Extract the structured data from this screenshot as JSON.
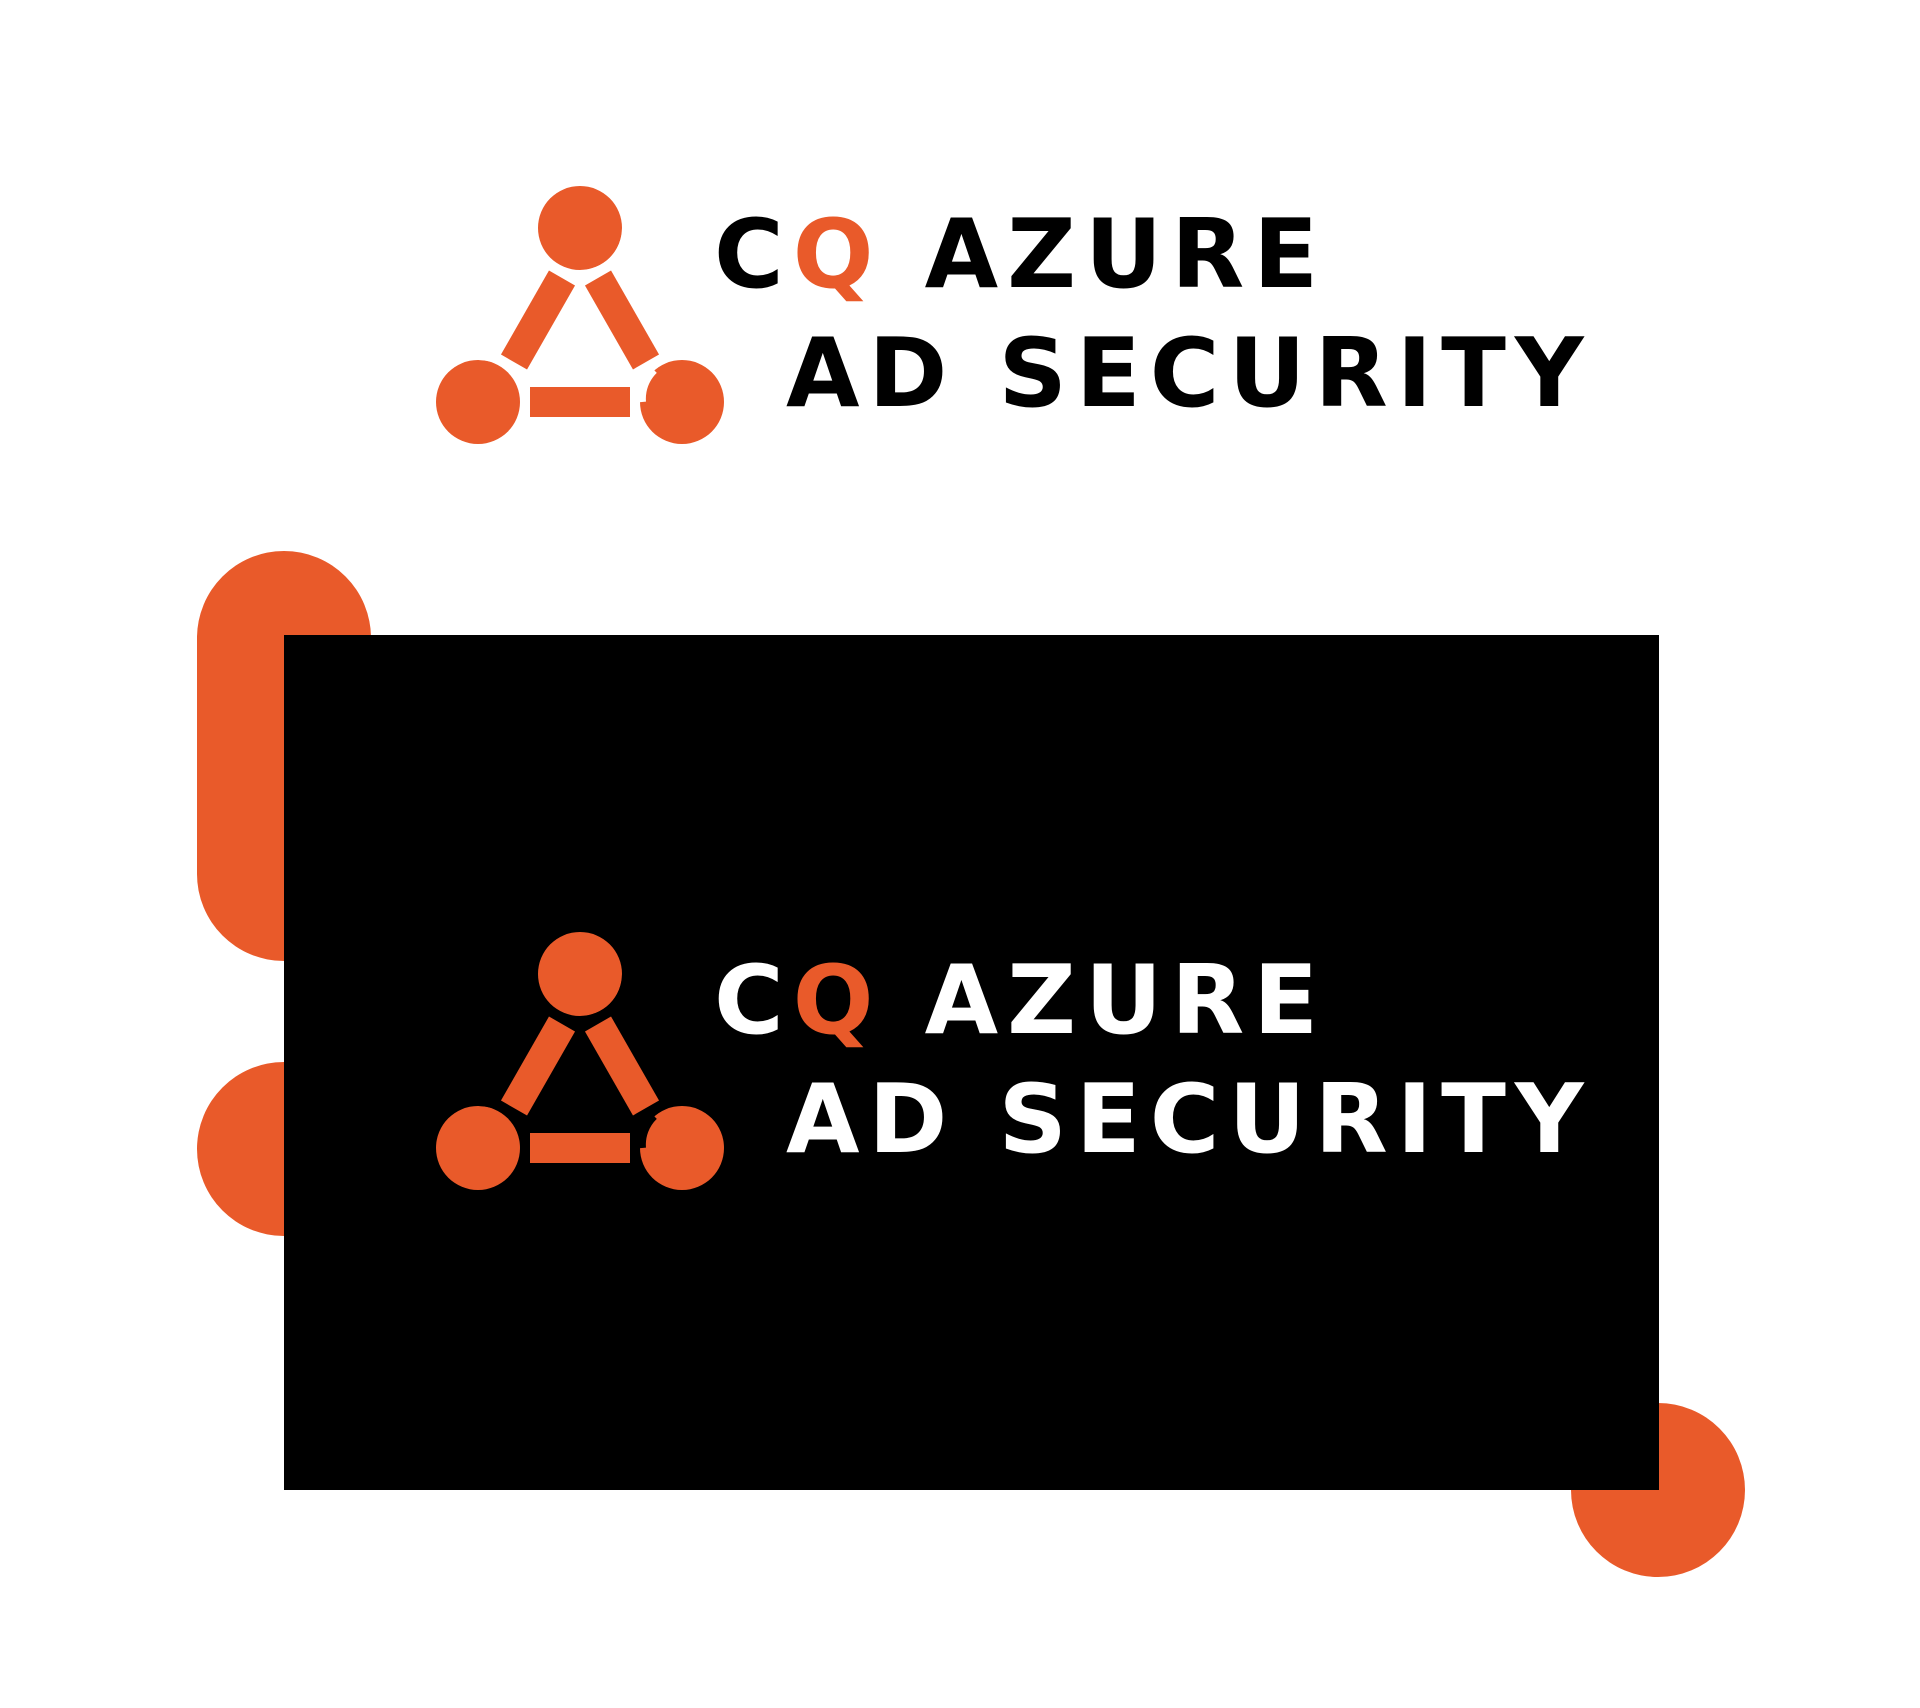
{
  "brand": {
    "accent_color": "#e95a2a",
    "light_background": "#ffffff",
    "dark_background": "#000000"
  },
  "logo": {
    "icon": "triangle-nodes-icon",
    "line1": {
      "prefix": "C",
      "highlight": "Q",
      "suffix": " AZURE"
    },
    "line2": "AD SECURITY"
  }
}
